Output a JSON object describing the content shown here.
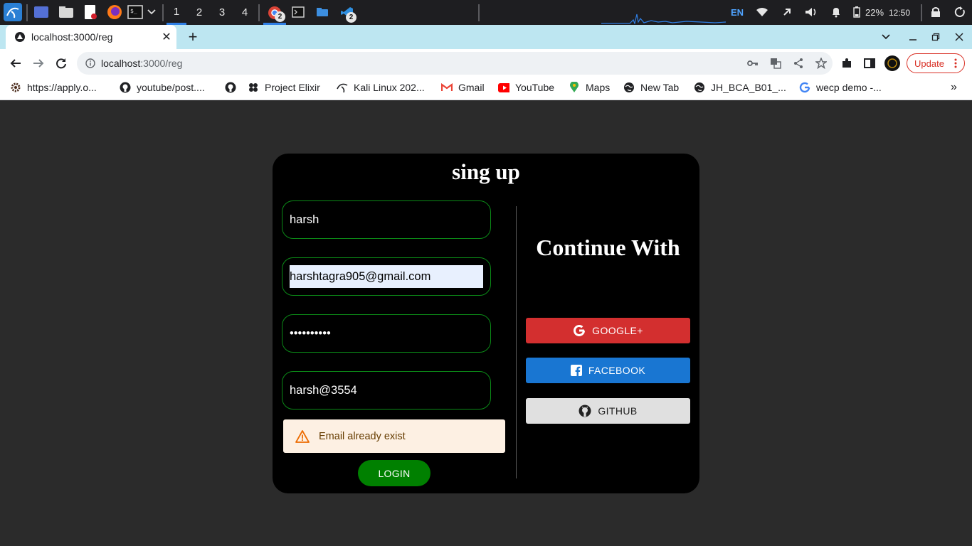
{
  "taskbar": {
    "workspaces": [
      "1",
      "2",
      "3",
      "4"
    ],
    "chrome_badge": "2",
    "vscode_badge": "2",
    "language": "EN",
    "battery": "22%",
    "clock": "12:50"
  },
  "browser": {
    "tab_title": "localhost:3000/reg",
    "url_host": "localhost",
    "url_path": ":3000/reg",
    "update_label": "Update",
    "bookmarks": [
      {
        "label": "https://apply.o...",
        "icon": "gear-icon"
      },
      {
        "label": "youtube/post....",
        "icon": "github-icon"
      },
      {
        "label": "",
        "icon": "github-icon"
      },
      {
        "label": "Project Elixir",
        "icon": "elixir-icon"
      },
      {
        "label": "Kali Linux 202...",
        "icon": "kali-icon"
      },
      {
        "label": "Gmail",
        "icon": "gmail-icon"
      },
      {
        "label": "YouTube",
        "icon": "youtube-icon"
      },
      {
        "label": "Maps",
        "icon": "maps-icon"
      },
      {
        "label": "New Tab",
        "icon": "globe-icon"
      },
      {
        "label": "JH_BCA_B01_...",
        "icon": "globe-icon"
      },
      {
        "label": "wecp demo -...",
        "icon": "google-icon"
      }
    ],
    "more_bookmarks": "»"
  },
  "form": {
    "title": "sing up",
    "name_value": "harsh",
    "email_value": "harshtagra905@gmail.com",
    "password_value": "••••••••••",
    "confirm_value": "harsh@3554",
    "alert_text": "Email already exist",
    "login_label": "LOGIN"
  },
  "social": {
    "heading": "Continue With",
    "google_label": "GOOGLE+",
    "facebook_label": "FACEBOOK",
    "github_label": "GITHUB"
  },
  "colors": {
    "card_bg": "#000000",
    "page_bg": "#2b2b2b",
    "field_border": "#0b8a17",
    "login_bg": "#008000",
    "google_bg": "#d32f2f",
    "facebook_bg": "#1976d2",
    "github_bg": "#e0e0e0",
    "alert_bg": "#fdf0e3",
    "alert_icon": "#ed6c02"
  }
}
